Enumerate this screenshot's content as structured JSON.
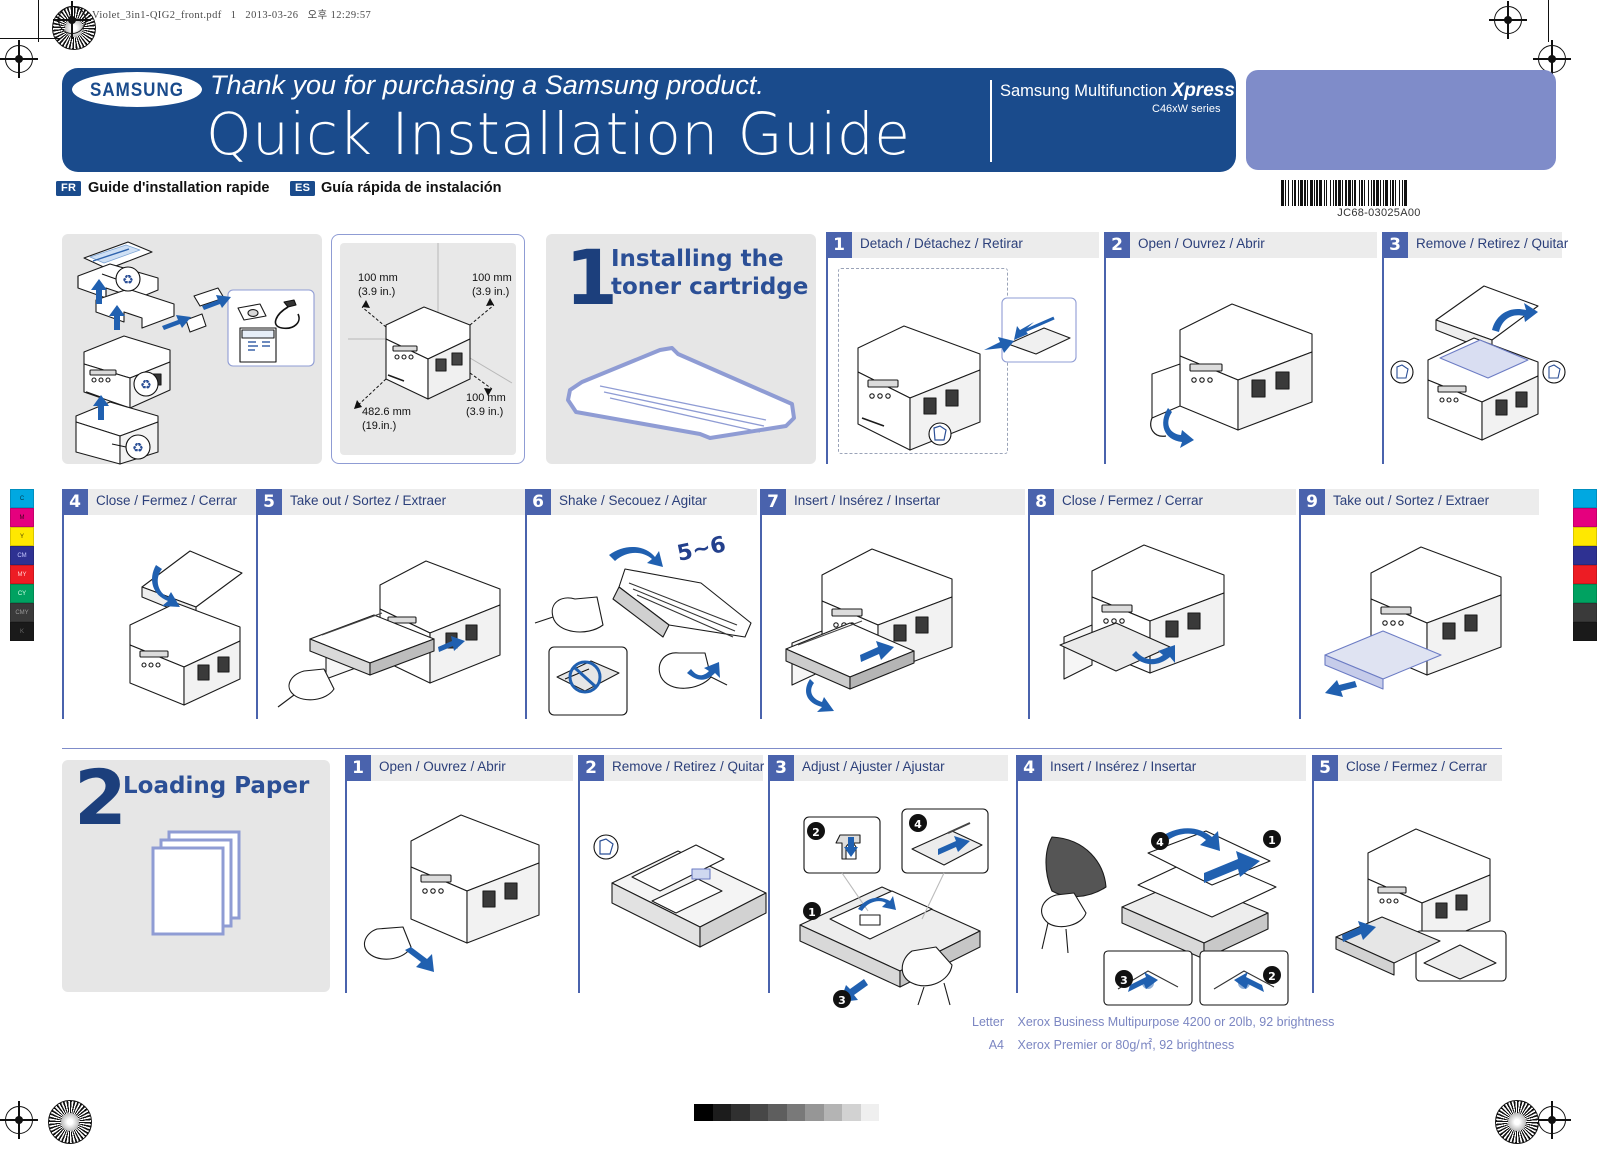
{
  "slug": "Violet_3in1-QIG2_front.pdf   1   2013-03-26   오후 12:29:57",
  "header": {
    "logo_text": "SAMSUNG",
    "tagline": "Thank you for purchasing a Samsung product.",
    "title": "Quick Installation Guide",
    "model_prefix": "Samsung Multifunction ",
    "model_brand": "Xpress",
    "model_series": "C46xW series",
    "accent_blue": "#1a4b8c",
    "accent_purple": "#7f8cc9"
  },
  "languages": [
    {
      "tag": "FR",
      "label": "Guide d'installation rapide"
    },
    {
      "tag": "ES",
      "label": "Guía rápida de instalación"
    }
  ],
  "barcode": {
    "label": "JC68-03025A00"
  },
  "clearance": {
    "top_left": "100 mm\n(3.9 in.)",
    "top_right": "100 mm\n(3.9 in.)",
    "bottom_right": "100 mm\n(3.9 in.)",
    "depth": "482.6 mm\n(19.in.)"
  },
  "sections": [
    {
      "number": "1",
      "label": "Installing the\ntoner cartridge",
      "steps": [
        {
          "num": "1",
          "title": "Detach / Détachez / Retirar"
        },
        {
          "num": "2",
          "title": "Open / Ouvrez / Abrir"
        },
        {
          "num": "3",
          "title": "Remove / Retirez / Quitar"
        },
        {
          "num": "4",
          "title": "Close / Fermez / Cerrar"
        },
        {
          "num": "5",
          "title": "Take out /  Sortez / Extraer"
        },
        {
          "num": "6",
          "title": "Shake / Secouez / Agitar"
        },
        {
          "num": "7",
          "title": "Insert / Insérez / Insertar"
        },
        {
          "num": "8",
          "title": "Close / Fermez / Cerrar"
        },
        {
          "num": "9",
          "title": "Take out /  Sortez / Extraer"
        }
      ],
      "shake_count": "5~6"
    },
    {
      "number": "2",
      "label": "Loading Paper",
      "steps": [
        {
          "num": "1",
          "title": "Open / Ouvrez / Abrir"
        },
        {
          "num": "2",
          "title": "Remove / Retirez / Quitar"
        },
        {
          "num": "3",
          "title": "Adjust / Ajuster / Ajustar"
        },
        {
          "num": "4",
          "title": "Insert / Insérez / Insertar"
        },
        {
          "num": "5",
          "title": "Close / Fermez / Cerrar"
        }
      ],
      "callouts_step3": [
        "1",
        "2",
        "3",
        "4"
      ],
      "callouts_step4": [
        "1",
        "2",
        "3",
        "4"
      ]
    }
  ],
  "paper_spec": [
    {
      "size": "Letter",
      "desc": "Xerox Business Multipurpose 4200 or 20lb, 92 brightness"
    },
    {
      "size": "A4",
      "desc": "Xerox Premier or 80g/㎡, 92 brightness"
    }
  ],
  "color_bars": [
    {
      "name": "C",
      "hex": "#00a8e1",
      "text": "#003344"
    },
    {
      "name": "M",
      "hex": "#e5007e",
      "text": "#440022"
    },
    {
      "name": "Y",
      "hex": "#ffe800",
      "text": "#443c00"
    },
    {
      "name": "CM",
      "hex": "#2e3192",
      "text": "#c6c8ff"
    },
    {
      "name": "MY",
      "hex": "#ed1c24",
      "text": "#ffd0d0"
    },
    {
      "name": "CY",
      "hex": "#00a261",
      "text": "#d6ffe8"
    },
    {
      "name": "CMY",
      "hex": "#3a3a3a",
      "text": "#9a9a9a"
    },
    {
      "name": "K",
      "hex": "#1a1a1a",
      "text": "#6a6a6a"
    }
  ],
  "gray_ramp": [
    "#000000",
    "#1c1c1c",
    "#303030",
    "#474747",
    "#5e5e5e",
    "#797979",
    "#969696",
    "#b4b4b4",
    "#d2d2d2",
    "#efefef"
  ]
}
